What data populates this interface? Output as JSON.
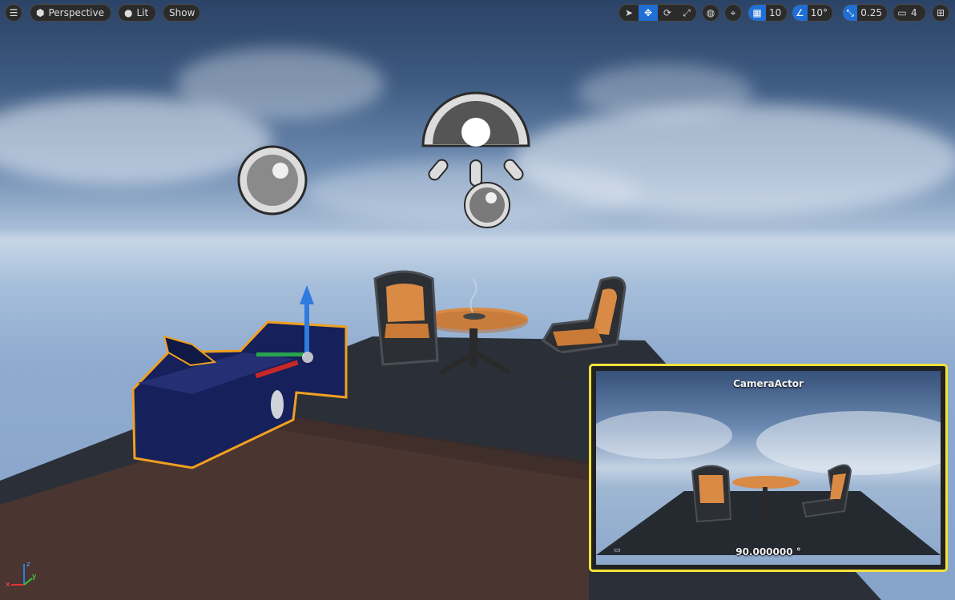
{
  "toolbar": {
    "menu_icon": "hamburger-menu-icon",
    "perspective_label": "Perspective",
    "lit_label": "Lit",
    "show_label": "Show",
    "grid_snap_value": "10",
    "rotation_snap_value": "10°",
    "scale_snap_value": "0.25",
    "camera_speed_value": "4"
  },
  "preview": {
    "title": "CameraActor",
    "fov": "90.000000 °"
  },
  "colors": {
    "accent_blue": "#1f6fd6",
    "selection_orange": "#f0a020",
    "preview_border": "#f3e23a",
    "toolbar_bg": "#2b2b2b"
  }
}
